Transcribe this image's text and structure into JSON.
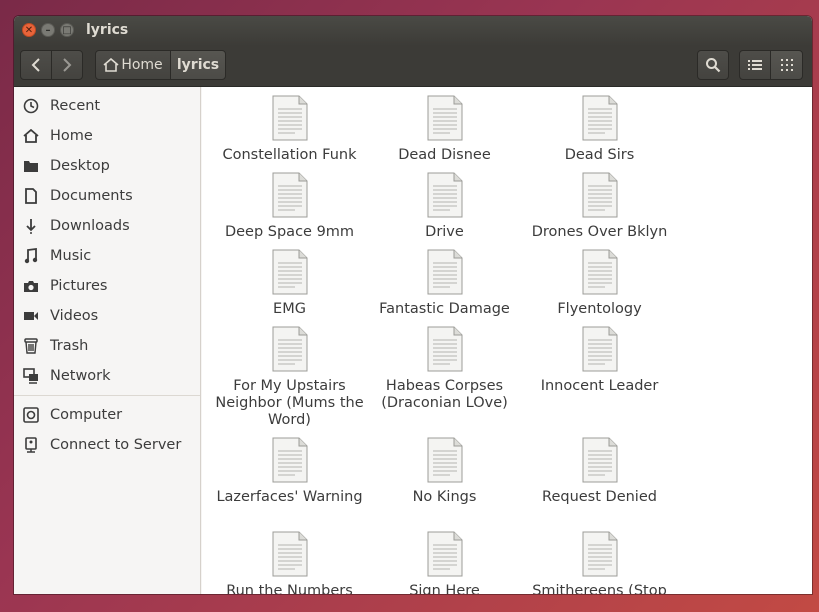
{
  "window": {
    "title": "lyrics"
  },
  "toolbar": {
    "home_label": "Home",
    "current_label": "lyrics"
  },
  "sidebar": {
    "items": [
      {
        "label": "Recent",
        "icon": "recent-icon"
      },
      {
        "label": "Home",
        "icon": "home-icon"
      },
      {
        "label": "Desktop",
        "icon": "folder-icon"
      },
      {
        "label": "Documents",
        "icon": "document-icon"
      },
      {
        "label": "Downloads",
        "icon": "download-icon"
      },
      {
        "label": "Music",
        "icon": "music-icon"
      },
      {
        "label": "Pictures",
        "icon": "camera-icon"
      },
      {
        "label": "Videos",
        "icon": "video-icon"
      },
      {
        "label": "Trash",
        "icon": "trash-icon"
      },
      {
        "label": "Network",
        "icon": "network-icon"
      }
    ],
    "items2": [
      {
        "label": "Computer",
        "icon": "computer-icon"
      },
      {
        "label": "Connect to Server",
        "icon": "server-icon"
      }
    ]
  },
  "files": [
    "Constellation Funk",
    "Dead Disnee",
    "Dead Sirs",
    "Deep Space 9mm",
    "Drive",
    "Drones Over Bklyn",
    "EMG",
    "Fantastic Damage",
    "Flyentology",
    "For My Upstairs Neighbor (Mums the Word)",
    "Habeas Corpses (Draconian LOve)",
    "Innocent Leader",
    "Lazerfaces' Warning",
    "No Kings",
    "Request Denied",
    "Run the Numbers",
    "Sign Here",
    "Smithereens (Stop"
  ],
  "colors": {
    "accent": "#e9643a",
    "titlebar": "#3c3b37"
  }
}
